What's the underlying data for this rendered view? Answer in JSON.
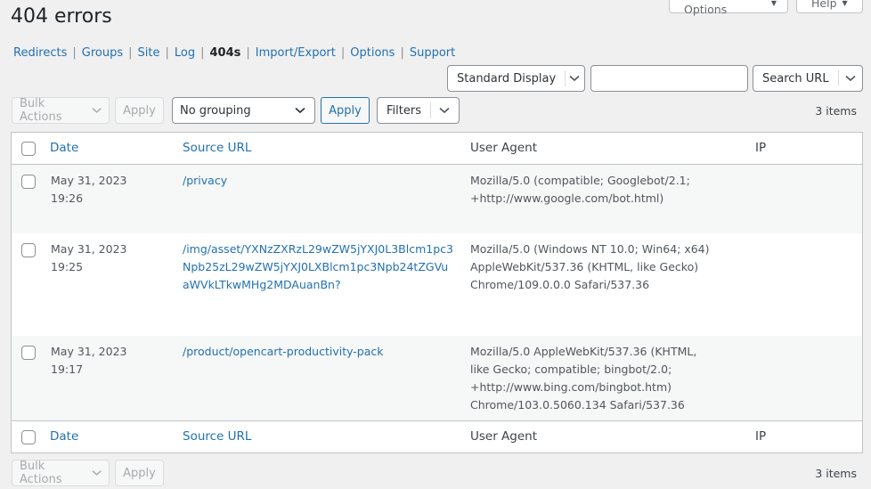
{
  "screen_tabs": {
    "screen_options": "Screen Options",
    "help": "Help"
  },
  "page_title": "404 errors",
  "subsubsub": [
    {
      "label": "Redirects",
      "current": false
    },
    {
      "label": "Groups",
      "current": false
    },
    {
      "label": "Site",
      "current": false
    },
    {
      "label": "Log",
      "current": false
    },
    {
      "label": "404s",
      "current": true
    },
    {
      "label": "Import/Export",
      "current": false
    },
    {
      "label": "Options",
      "current": false
    },
    {
      "label": "Support",
      "current": false
    }
  ],
  "search_bar": {
    "display_select": "Standard Display",
    "search_input_value": "",
    "search_button": "Search URL"
  },
  "top_nav": {
    "bulk_actions": "Bulk Actions",
    "apply_disabled": "Apply",
    "grouping_select": "No grouping",
    "apply": "Apply",
    "filters": "Filters",
    "items_count": "3 items"
  },
  "table": {
    "columns": [
      "Date",
      "Source URL",
      "User Agent",
      "IP"
    ],
    "rows": [
      {
        "date": "May 31, 2023",
        "time": "19:26",
        "source_url": "/privacy",
        "user_agent": "Mozilla/5.0 (compatible; Googlebot/2.1; +http://www.google.com/bot.html)",
        "ip": ""
      },
      {
        "date": "May 31, 2023",
        "time": "19:25",
        "source_url": "/img/asset/YXNzZXRzL29wZW5jYXJ0L3Blcm1pc3Npb25zL29wZW5jYXJ0LXBlcm1pc3Npb24tZGVuaWVkLTkwMHg2MDAuanBn?",
        "user_agent": "Mozilla/5.0 (Windows NT 10.0; Win64; x64) AppleWebKit/537.36 (KHTML, like Gecko) Chrome/109.0.0.0 Safari/537.36",
        "ip": ""
      },
      {
        "date": "May 31, 2023",
        "time": "19:17",
        "source_url": "/product/opencart-productivity-pack",
        "user_agent": "Mozilla/5.0 AppleWebKit/537.36 (KHTML, like Gecko; compatible; bingbot/2.0; +http://www.bing.com/bingbot.htm) Chrome/103.0.5060.134 Safari/537.36",
        "ip": ""
      }
    ]
  },
  "bottom_nav": {
    "bulk_actions": "Bulk Actions",
    "apply_disabled": "Apply",
    "items_count": "3 items"
  }
}
